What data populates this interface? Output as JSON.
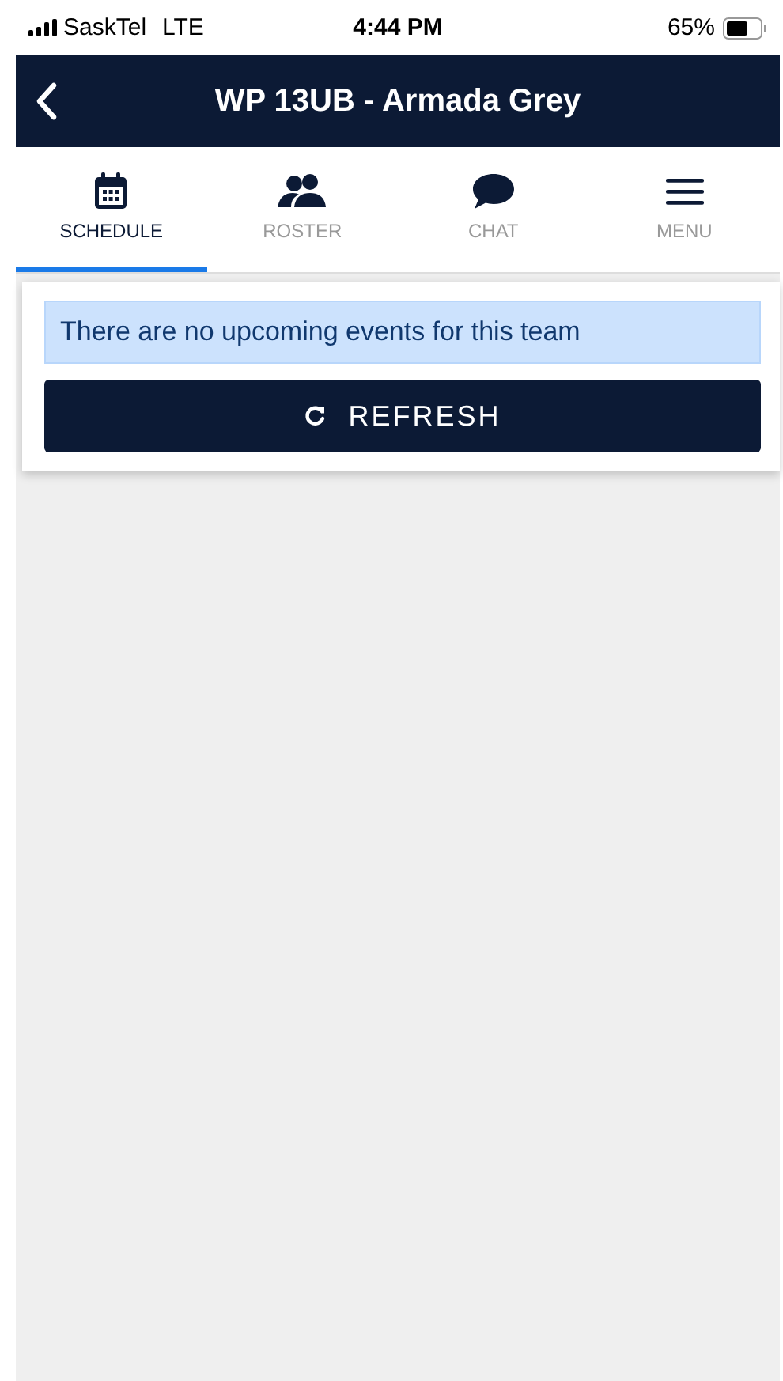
{
  "status_bar": {
    "carrier": "SaskTel",
    "network": "LTE",
    "time": "4:44 PM",
    "battery": "65%"
  },
  "header": {
    "title": "WP 13UB - Armada Grey"
  },
  "tabs": [
    {
      "label": "SCHEDULE",
      "kind": "calendar",
      "selected": true
    },
    {
      "label": "ROSTER",
      "kind": "people",
      "selected": false
    },
    {
      "label": "CHAT",
      "kind": "chat",
      "selected": false
    },
    {
      "label": "MENU",
      "kind": "menu",
      "selected": false
    }
  ],
  "notice": "There are no upcoming events for this team",
  "refresh_button": {
    "label": "REFRESH"
  }
}
